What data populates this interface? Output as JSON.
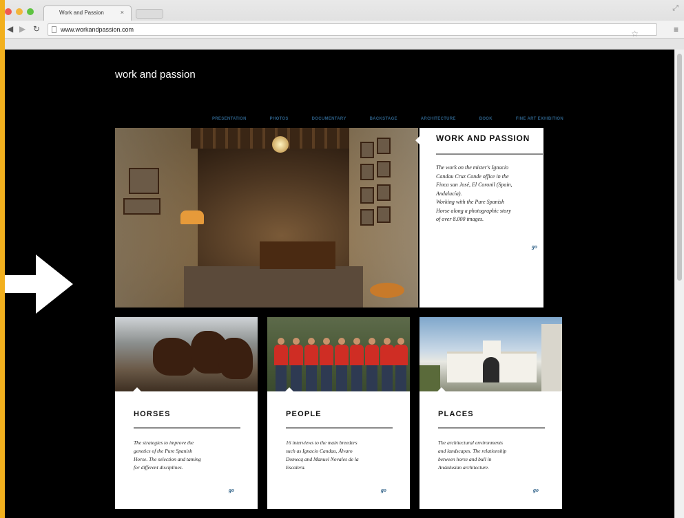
{
  "browser": {
    "tab_title": "Work and Passion",
    "tab_close": "×",
    "url": "www.workandpassion.com",
    "icons": [
      "back-icon",
      "forward-icon",
      "reload-icon",
      "page-icon",
      "star-icon",
      "menu-icon",
      "resize-icon"
    ]
  },
  "site": {
    "title": "work and passion",
    "menu": [
      "PRESENTATION",
      "PHOTOS",
      "DOCUMENTARY",
      "BACKSTAGE",
      "ARCHITECTURE",
      "BOOK",
      "FINE ART EXHIBITION"
    ]
  },
  "hero": {
    "title": "WORK AND PASSION",
    "description_lines": [
      "The work on the mister's Ignacio",
      "Candau Cruz Conde office in the",
      "Finca san José, El Coronil (Spain,",
      "Andalucía).",
      "Working with the Pure Spanish",
      "Horse along a photographic story",
      "of over 8.000 images."
    ],
    "go_label": "go"
  },
  "cards": [
    {
      "title": "HORSES",
      "description_lines": [
        "The strategies to improve the",
        "genetics of the Pure Spanish",
        "Horse. The selection and taming",
        "for different disciplines."
      ],
      "go_label": "go"
    },
    {
      "title": "PEOPLE",
      "description_lines": [
        "16 interviews to the main breeders",
        "such as Ignacio Candau, Álvaro",
        "Domecq and Manuel Novales de la",
        "Escalera."
      ],
      "go_label": "go"
    },
    {
      "title": "PLACES",
      "description_lines": [
        "The architectural environments",
        "and landscapes. The relationship",
        "between horse and bull in",
        "Andalusian architecture."
      ],
      "go_label": "go"
    }
  ],
  "colors": {
    "accent": "#2c5f86",
    "side_bar": "#f2b01e",
    "page_bg": "#000000",
    "card_bg": "#ffffff"
  }
}
